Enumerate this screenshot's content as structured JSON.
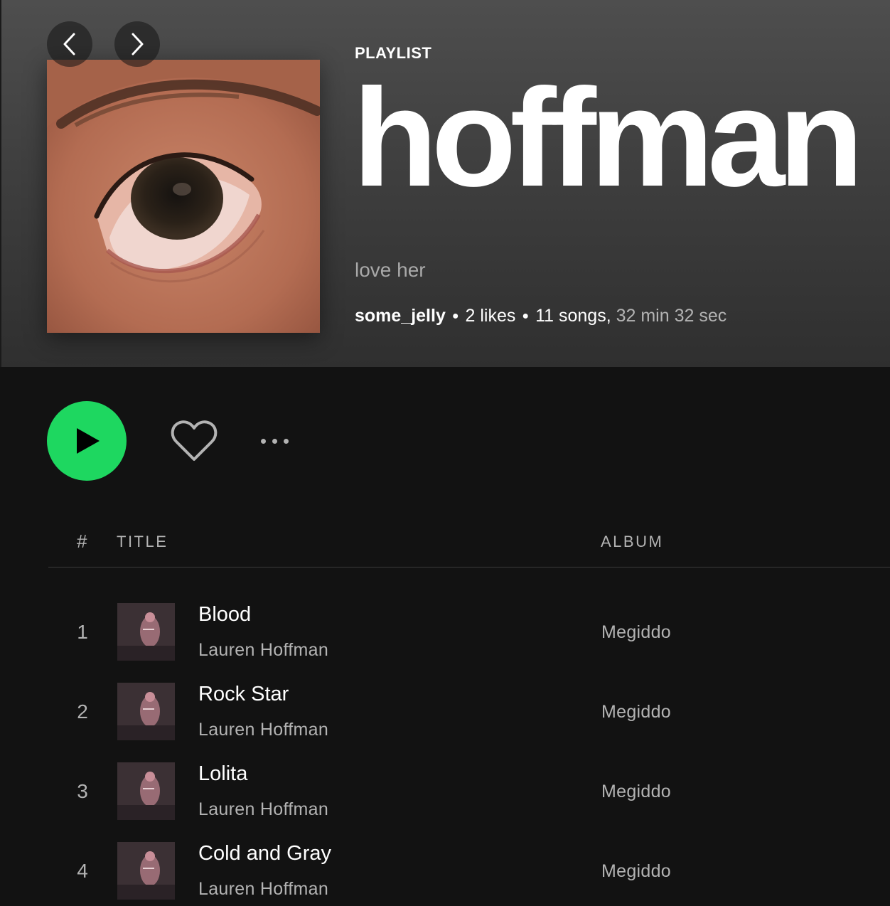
{
  "nav": {
    "back_icon": "chevron-left-icon",
    "forward_icon": "chevron-right-icon"
  },
  "playlist": {
    "type_label": "PLAYLIST",
    "title": "hoffman",
    "description": "love her",
    "owner": "some_jelly",
    "likes": "2 likes",
    "songs": "11 songs,",
    "duration": "32 min 32 sec",
    "cover_icon": "eye-photo"
  },
  "controls": {
    "play_icon": "play-icon",
    "like_icon": "heart-icon",
    "more_icon": "more-options-icon",
    "accent_color": "#1ed760"
  },
  "table": {
    "headers": {
      "num": "#",
      "title": "TITLE",
      "album": "ALBUM"
    },
    "tracks": [
      {
        "num": "1",
        "title": "Blood",
        "artist": "Lauren Hoffman",
        "album": "Megiddo"
      },
      {
        "num": "2",
        "title": "Rock Star",
        "artist": "Lauren Hoffman",
        "album": "Megiddo"
      },
      {
        "num": "3",
        "title": "Lolita",
        "artist": "Lauren Hoffman",
        "album": "Megiddo"
      },
      {
        "num": "4",
        "title": "Cold and Gray",
        "artist": "Lauren Hoffman",
        "album": "Megiddo"
      }
    ]
  }
}
